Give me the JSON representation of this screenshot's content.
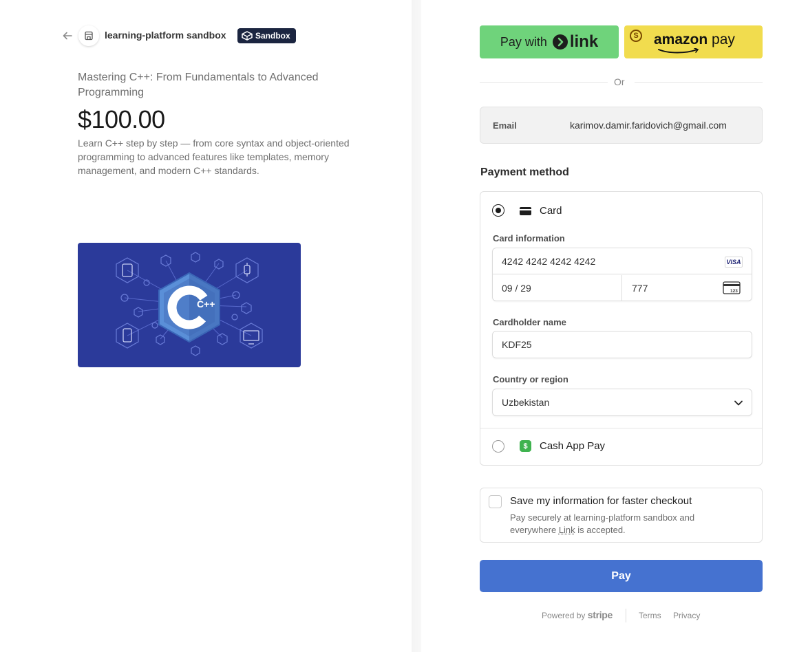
{
  "merchant": {
    "name": "learning-platform sandbox",
    "badge": "Sandbox"
  },
  "product": {
    "name": "Mastering C++: From Fundamentals to Advanced Programming",
    "price": "$100.00",
    "description": "Learn C++ step by step — from core syntax and object-oriented programming to advanced features like templates, memory management, and modern C++ standards.",
    "image_text": "C++"
  },
  "express": {
    "link_prefix": "Pay with",
    "link_brand": "link",
    "amazon_brand_a": "amazon",
    "amazon_brand_b": " pay",
    "amazon_coin": "S",
    "divider": "Or"
  },
  "email": {
    "label": "Email",
    "value": "karimov.damir.faridovich@gmail.com"
  },
  "payment": {
    "title": "Payment method",
    "card_label": "Card",
    "card_info_label": "Card information",
    "card_number": "4242 4242 4242 4242",
    "card_brand": "VISA",
    "expiry": "09 / 29",
    "cvc": "777",
    "cvc_icon_text": "123",
    "cardholder_label": "Cardholder name",
    "cardholder_value": "KDF25",
    "country_label": "Country or region",
    "country_value": "Uzbekistan",
    "cashapp_label": "Cash App Pay",
    "cashapp_icon": "$"
  },
  "save": {
    "title": "Save my information for faster checkout",
    "desc_a": "Pay securely at learning-platform sandbox and everywhere ",
    "desc_link": "Link",
    "desc_b": " is accepted."
  },
  "pay_button": "Pay",
  "footer": {
    "powered_by": "Powered by",
    "stripe": "stripe",
    "terms": "Terms",
    "privacy": "Privacy"
  },
  "colors": {
    "link_green": "#6fd37b",
    "amazon_yellow": "#f1dc4e",
    "pay_blue": "#4572d0",
    "image_bg": "#2b3a9a",
    "badge_navy": "#1b2540"
  },
  "icons": [
    "back-arrow-icon",
    "store-icon",
    "sandbox-icon",
    "link-chevron-icon",
    "card-icon",
    "visa-icon",
    "cvc-icon",
    "chevron-down-icon",
    "cash-app-icon"
  ]
}
